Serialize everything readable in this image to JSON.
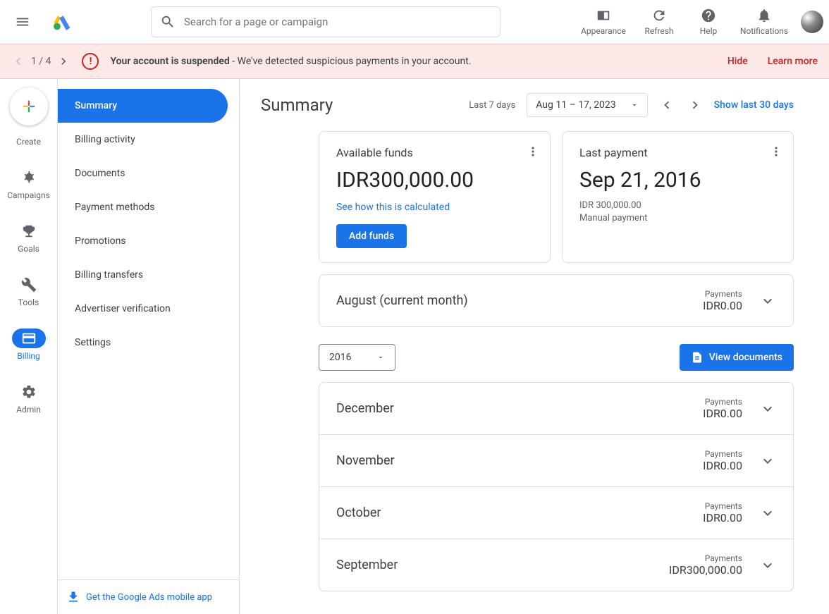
{
  "search": {
    "placeholder": "Search for a page or campaign"
  },
  "headerActions": {
    "appearance": "Appearance",
    "refresh": "Refresh",
    "help": "Help",
    "notifications": "Notifications"
  },
  "alert": {
    "count": "1 / 4",
    "bold": "Your account is suspended",
    "rest": " - We've detected suspicious payments in your account.",
    "hide": "Hide",
    "learn": "Learn more"
  },
  "rail": {
    "create": "Create",
    "campaigns": "Campaigns",
    "goals": "Goals",
    "tools": "Tools",
    "billing": "Billing",
    "admin": "Admin"
  },
  "sidenav": [
    "Summary",
    "Billing activity",
    "Documents",
    "Payment methods",
    "Promotions",
    "Billing transfers",
    "Advertiser verification",
    "Settings"
  ],
  "sidenavBottom": "Get the Google Ads mobile app",
  "page": {
    "title": "Summary",
    "last7": "Last 7 days",
    "dateRange": "Aug 11 – 17, 2023",
    "show30": "Show last 30 days"
  },
  "cardFunds": {
    "label": "Available funds",
    "amount": "IDR300,000.00",
    "link": "See how this is calculated",
    "button": "Add funds"
  },
  "cardPayment": {
    "label": "Last payment",
    "date": "Sep 21, 2016",
    "amount": "IDR 300,000.00",
    "method": "Manual payment"
  },
  "currentMonth": {
    "label": "August (current month)",
    "payLabel": "Payments",
    "amount": "IDR0.00"
  },
  "yearSel": "2016",
  "viewDocs": "View documents",
  "months": [
    {
      "name": "December",
      "payLabel": "Payments",
      "amount": "IDR0.00"
    },
    {
      "name": "November",
      "payLabel": "Payments",
      "amount": "IDR0.00"
    },
    {
      "name": "October",
      "payLabel": "Payments",
      "amount": "IDR0.00"
    },
    {
      "name": "September",
      "payLabel": "Payments",
      "amount": "IDR300,000.00"
    }
  ]
}
